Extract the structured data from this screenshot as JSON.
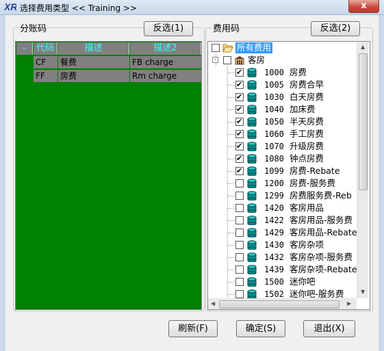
{
  "window": {
    "title": "选择费用类型  << Training >>",
    "close_label": "x"
  },
  "left_panel": {
    "title": "分账码",
    "invert_button": "反选(1)",
    "columns": [
      "-",
      "代码",
      "描述",
      "描述2"
    ],
    "rows": [
      {
        "code": "CF",
        "desc": "餐费",
        "desc2": "FB charge"
      },
      {
        "code": "FF",
        "desc": "房费",
        "desc2": "Rm charge"
      }
    ]
  },
  "right_panel": {
    "title": "费用码",
    "invert_button": "反选(2)",
    "root_label": "所有费用",
    "group_label": "客房",
    "items": [
      {
        "code": "1000",
        "desc": "房费",
        "checked": true
      },
      {
        "code": "1005",
        "desc": "房费合早",
        "checked": true
      },
      {
        "code": "1030",
        "desc": "白天房费",
        "checked": true
      },
      {
        "code": "1040",
        "desc": "加床费",
        "checked": true
      },
      {
        "code": "1050",
        "desc": "半天房费",
        "checked": true
      },
      {
        "code": "1060",
        "desc": "手工房费",
        "checked": true
      },
      {
        "code": "1070",
        "desc": "升级房费",
        "checked": true
      },
      {
        "code": "1080",
        "desc": "钟点房费",
        "checked": true
      },
      {
        "code": "1099",
        "desc": "房费-Rebate",
        "checked": true
      },
      {
        "code": "1200",
        "desc": "房费-服务费",
        "checked": false
      },
      {
        "code": "1299",
        "desc": "房费服务费-Reb",
        "checked": false
      },
      {
        "code": "1420",
        "desc": "客房用品",
        "checked": false
      },
      {
        "code": "1422",
        "desc": "客房用品-服务费",
        "checked": false
      },
      {
        "code": "1429",
        "desc": "客房用品-Rebate",
        "checked": false
      },
      {
        "code": "1430",
        "desc": "客房杂项",
        "checked": false
      },
      {
        "code": "1432",
        "desc": "客房杂项-服务费",
        "checked": false
      },
      {
        "code": "1439",
        "desc": "客房杂项-Rebate",
        "checked": false
      },
      {
        "code": "1500",
        "desc": "迷你吧",
        "checked": false
      },
      {
        "code": "1502",
        "desc": "迷你吧-服务费",
        "checked": false
      }
    ]
  },
  "footer": {
    "refresh": "刷新(F)",
    "ok": "确定(S)",
    "exit": "退出(X)"
  },
  "colors": {
    "grid_bg": "#008000",
    "header_bg": "#808080",
    "header_text": "#33ffff",
    "root_highlight": "#3399ff"
  },
  "icons": {
    "app": "xr-logo-icon",
    "close": "close-icon",
    "folder": "folder-open-icon",
    "group": "building-icon",
    "item": "database-cylinder-icon"
  }
}
